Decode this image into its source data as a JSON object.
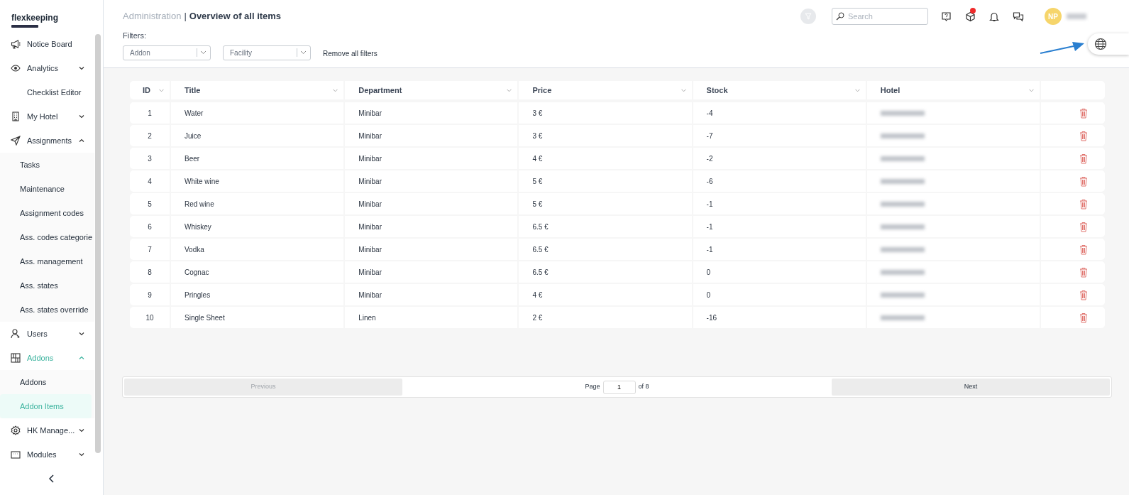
{
  "sidebar": {
    "logo": "flexkeeping",
    "items": [
      {
        "label": "Notice Board",
        "kind": "link",
        "selected": false
      },
      {
        "label": "Analytics",
        "kind": "group",
        "expanded": false,
        "selected": false
      },
      {
        "label": "Checklist Editor",
        "kind": "link",
        "selected": false
      },
      {
        "label": "My Hotel",
        "kind": "group",
        "expanded": false,
        "selected": false
      },
      {
        "label": "Assignments",
        "kind": "group",
        "expanded": true,
        "selected": false,
        "children": [
          {
            "label": "Tasks",
            "selected": false
          },
          {
            "label": "Maintenance",
            "selected": false
          },
          {
            "label": "Assignment codes",
            "selected": false
          },
          {
            "label": "Ass. codes categorie",
            "selected": false
          },
          {
            "label": "Ass. management",
            "selected": false
          },
          {
            "label": "Ass. states",
            "selected": false
          },
          {
            "label": "Ass. states override",
            "selected": false
          }
        ]
      },
      {
        "label": "Users",
        "kind": "group",
        "expanded": false,
        "selected": false
      },
      {
        "label": "Addons",
        "kind": "group",
        "expanded": true,
        "selected": true,
        "children": [
          {
            "label": "Addons",
            "selected": false
          },
          {
            "label": "Addon Items",
            "selected": true
          }
        ]
      },
      {
        "label": "HK Manage...",
        "kind": "group",
        "expanded": false,
        "selected": false
      },
      {
        "label": "Modules",
        "kind": "group",
        "expanded": false,
        "selected": false
      }
    ]
  },
  "header": {
    "breadcrumb_parent": "Administration",
    "separator": "|",
    "title": "Overview of all items",
    "search": {
      "placeholder": "Search"
    },
    "avatar": "NP"
  },
  "filters": {
    "label": "Filters:",
    "selects": [
      {
        "placeholder": "Addon"
      },
      {
        "placeholder": "Facility"
      }
    ],
    "clear": "Remove all filters"
  },
  "table": {
    "columns": [
      "ID",
      "Title",
      "Department",
      "Price",
      "Stock",
      "Hotel"
    ],
    "rows": [
      {
        "id": "1",
        "title": "Water",
        "department": "Minibar",
        "price": "3 €",
        "stock": "-4"
      },
      {
        "id": "2",
        "title": "Juice",
        "department": "Minibar",
        "price": "3 €",
        "stock": "-7"
      },
      {
        "id": "3",
        "title": "Beer",
        "department": "Minibar",
        "price": "4 €",
        "stock": "-2"
      },
      {
        "id": "4",
        "title": "White wine",
        "department": "Minibar",
        "price": "5 €",
        "stock": "-6"
      },
      {
        "id": "5",
        "title": "Red wine",
        "department": "Minibar",
        "price": "5 €",
        "stock": "-1"
      },
      {
        "id": "6",
        "title": "Whiskey",
        "department": "Minibar",
        "price": "6.5 €",
        "stock": "-1"
      },
      {
        "id": "7",
        "title": "Vodka",
        "department": "Minibar",
        "price": "6.5 €",
        "stock": "-1"
      },
      {
        "id": "8",
        "title": "Cognac",
        "department": "Minibar",
        "price": "6.5 €",
        "stock": "0"
      },
      {
        "id": "9",
        "title": "Pringles",
        "department": "Minibar",
        "price": "4 €",
        "stock": "0"
      },
      {
        "id": "10",
        "title": "Single Sheet",
        "department": "Linen",
        "price": "2 €",
        "stock": "-16"
      }
    ]
  },
  "pagination": {
    "previous": "Previous",
    "previous_disabled": true,
    "page_label": "Page",
    "page": "1",
    "of": "of 8",
    "next": "Next"
  }
}
